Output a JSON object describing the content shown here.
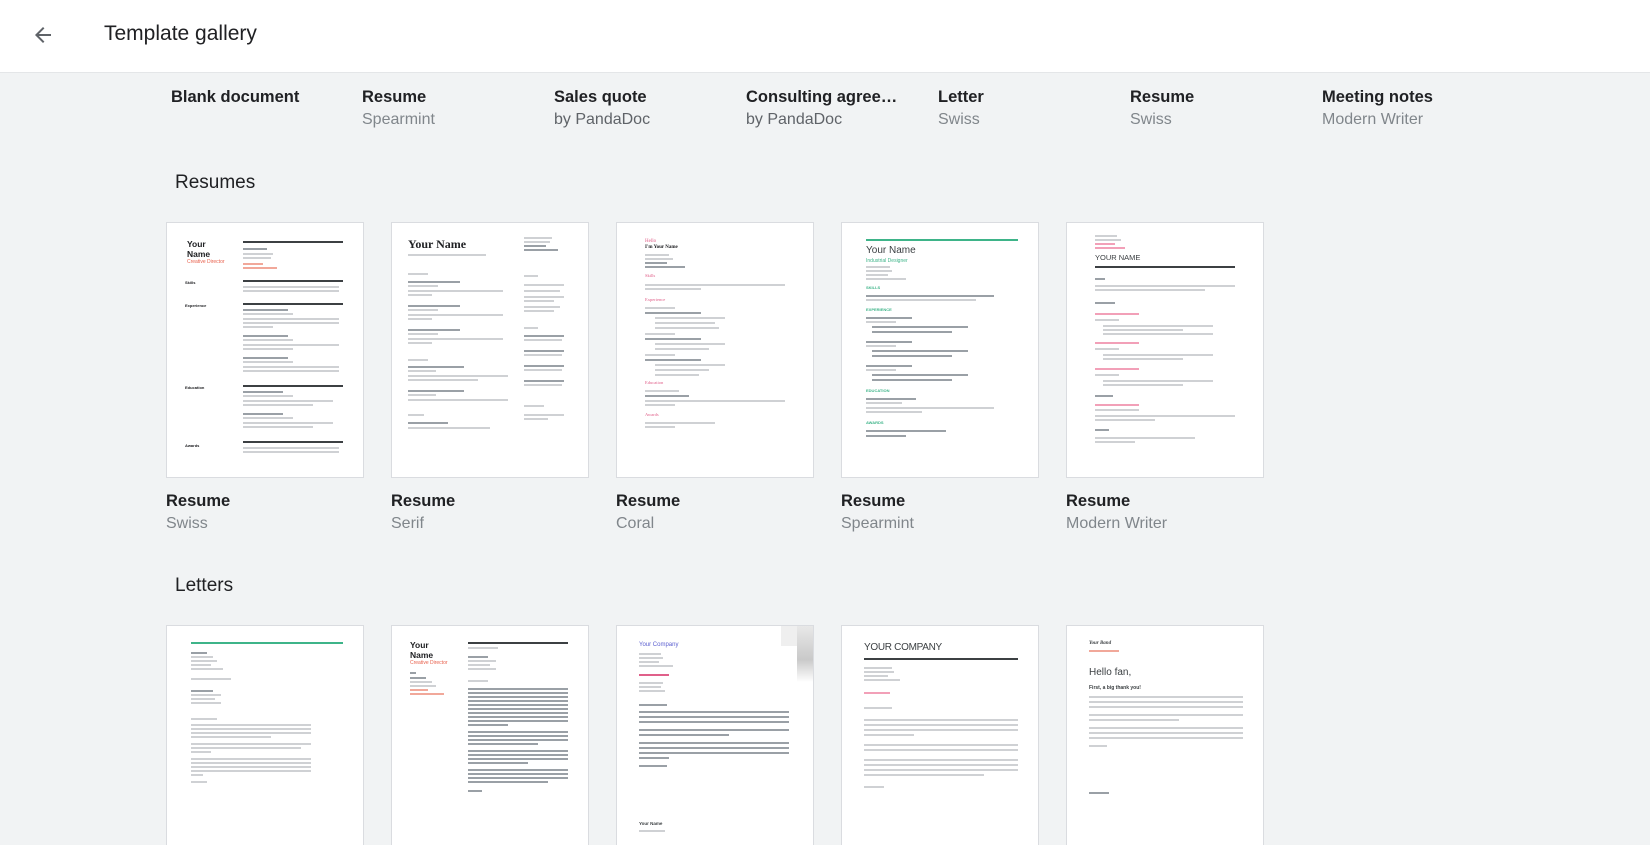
{
  "header": {
    "back_icon": "arrow-back-icon",
    "title": "Template gallery"
  },
  "quick_templates": [
    {
      "title": "Blank document",
      "subtitle": ""
    },
    {
      "title": "Resume",
      "subtitle": "Spearmint"
    },
    {
      "title": "Sales quote",
      "subtitle": "by PandaDoc"
    },
    {
      "title": "Consulting agreem...",
      "subtitle": "by PandaDoc"
    },
    {
      "title": "Letter",
      "subtitle": "Swiss"
    },
    {
      "title": "Resume",
      "subtitle": "Swiss"
    },
    {
      "title": "Meeting notes",
      "subtitle": "Modern Writer"
    }
  ],
  "sections": [
    {
      "title": "Resumes",
      "templates": [
        {
          "title": "Resume",
          "subtitle": "Swiss",
          "preview": {
            "name": "Your Name",
            "role": "Creative Director",
            "labels": [
              "Skills",
              "Experience",
              "Education",
              "Awards"
            ],
            "accent": "#e8604c"
          }
        },
        {
          "title": "Resume",
          "subtitle": "Serif",
          "preview": {
            "name": "Your Name"
          }
        },
        {
          "title": "Resume",
          "subtitle": "Coral",
          "preview": {
            "greeting": "Hello",
            "name": "I'm Your Name",
            "headings": [
              "Skills",
              "Experience",
              "Education",
              "Awards"
            ],
            "accent": "#e0608a"
          }
        },
        {
          "title": "Resume",
          "subtitle": "Spearmint",
          "preview": {
            "name": "Your Name",
            "role": "Industrial Designer",
            "headings": [
              "SKILLS",
              "EXPERIENCE",
              "EDUCATION",
              "AWARDS"
            ],
            "accent": "#3eb489"
          }
        },
        {
          "title": "Resume",
          "subtitle": "Modern Writer",
          "preview": {
            "name": "YOUR NAME",
            "accent": "#e04a7a"
          }
        }
      ]
    },
    {
      "title": "Letters",
      "templates": [
        {
          "preview": {
            "accent": "#3eb489"
          }
        },
        {
          "preview": {
            "name": "Your Name",
            "role": "Creative Director",
            "accent": "#e8604c"
          }
        },
        {
          "preview": {
            "company": "Your Company",
            "signature": "Your Name",
            "accent": "#5b5fd0"
          }
        },
        {
          "preview": {
            "company": "YOUR COMPANY"
          }
        },
        {
          "preview": {
            "band": "Your Band",
            "greeting": "Hello fan,",
            "subheading": "First, a big thank you!"
          }
        }
      ]
    }
  ],
  "colors": {
    "background": "#f1f3f4",
    "header": "#ffffff",
    "title_text": "#202124",
    "subtitle_text": "#80868b"
  }
}
